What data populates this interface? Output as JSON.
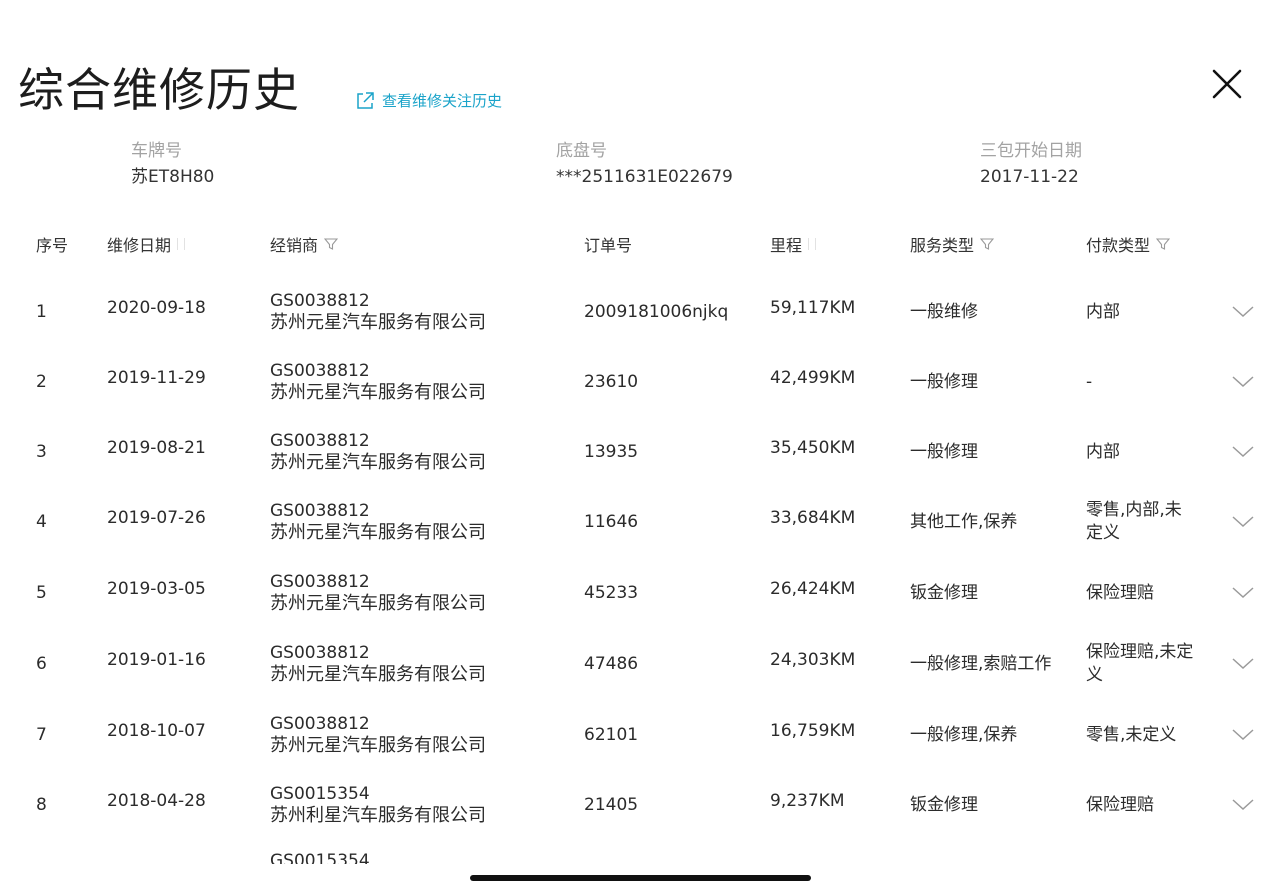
{
  "header": {
    "title": "综合维修历史",
    "link_label": "查看维修关注历史",
    "link_icon": "external-link-icon",
    "close_icon": "close-icon"
  },
  "vehicle": {
    "plate_label": "车牌号",
    "plate_value": "苏ET8H80",
    "chassis_label": "底盘号",
    "chassis_value": "***2511631E022679",
    "warranty_label": "三包开始日期",
    "warranty_value": "2017-11-22"
  },
  "table": {
    "headers": {
      "index": "序号",
      "date": "维修日期",
      "dealer": "经销商",
      "order": "订单号",
      "mileage": "里程",
      "service": "服务类型",
      "payment": "付款类型"
    },
    "rows": [
      {
        "index": "1",
        "date": "2020-09-18",
        "dealer_code": "GS0038812",
        "dealer_name": "苏州元星汽车服务有限公司",
        "order": "2009181006njkq",
        "mileage": "59,117KM",
        "service": "一般维修",
        "payment": "内部"
      },
      {
        "index": "2",
        "date": "2019-11-29",
        "dealer_code": "GS0038812",
        "dealer_name": "苏州元星汽车服务有限公司",
        "order": "23610",
        "mileage": "42,499KM",
        "service": "一般修理",
        "payment": "-"
      },
      {
        "index": "3",
        "date": "2019-08-21",
        "dealer_code": "GS0038812",
        "dealer_name": "苏州元星汽车服务有限公司",
        "order": "13935",
        "mileage": "35,450KM",
        "service": "一般修理",
        "payment": "内部"
      },
      {
        "index": "4",
        "date": "2019-07-26",
        "dealer_code": "GS0038812",
        "dealer_name": "苏州元星汽车服务有限公司",
        "order": "11646",
        "mileage": "33,684KM",
        "service": "其他工作,保养",
        "payment": "零售,内部,未定义"
      },
      {
        "index": "5",
        "date": "2019-03-05",
        "dealer_code": "GS0038812",
        "dealer_name": "苏州元星汽车服务有限公司",
        "order": "45233",
        "mileage": "26,424KM",
        "service": "钣金修理",
        "payment": "保险理赔"
      },
      {
        "index": "6",
        "date": "2019-01-16",
        "dealer_code": "GS0038812",
        "dealer_name": "苏州元星汽车服务有限公司",
        "order": "47486",
        "mileage": "24,303KM",
        "service": "一般修理,索赔工作",
        "payment": "保险理赔,未定义"
      },
      {
        "index": "7",
        "date": "2018-10-07",
        "dealer_code": "GS0038812",
        "dealer_name": "苏州元星汽车服务有限公司",
        "order": "62101",
        "mileage": "16,759KM",
        "service": "一般修理,保养",
        "payment": "零售,未定义"
      },
      {
        "index": "8",
        "date": "2018-04-28",
        "dealer_code": "GS0015354",
        "dealer_name": "苏州利星汽车服务有限公司",
        "order": "21405",
        "mileage": "9,237KM",
        "service": "钣金修理",
        "payment": "保险理赔"
      }
    ],
    "partial_row_code": "GS0015354"
  }
}
